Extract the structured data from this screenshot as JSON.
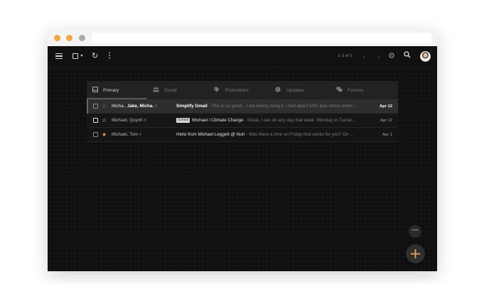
{
  "toolbar": {
    "page_count": "1–3 of 3",
    "icons": [
      "menu-icon",
      "checkbox-icon",
      "refresh-icon",
      "more-vert-icon",
      "chevron-left-icon",
      "chevron-right-icon",
      "gear-icon",
      "search-icon"
    ]
  },
  "tabs": [
    {
      "label": "Primary",
      "icon": "inbox-icon",
      "active": true
    },
    {
      "label": "Social",
      "icon": "people-icon",
      "active": false
    },
    {
      "label": "Promotions",
      "icon": "tag-icon",
      "active": false
    },
    {
      "label": "Updates",
      "icon": "info-icon",
      "active": false
    },
    {
      "label": "Forums",
      "icon": "forum-icon",
      "active": false
    }
  ],
  "emails": [
    {
      "sender_prefix": "Micha., ",
      "sender_bold": "Jake, Micha.",
      "count": "3",
      "label": "",
      "subject": "Simplify Gmail",
      "snippet": " - This is so good... I am loving using it. I feel about 50% less stress when ...",
      "date": "Apr 12",
      "starred": false,
      "unread": true
    },
    {
      "sender_prefix": "Michael, Quynh",
      "sender_bold": "",
      "count": "8",
      "label": "School",
      "subject": "Michael / Climate Change",
      "snippet": " - Great. I can do any day that week. Monday or Tuesd...",
      "date": "Apr 12",
      "starred": false,
      "unread": false
    },
    {
      "sender_prefix": "Michael, Tom",
      "sender_bold": "",
      "count": "4",
      "label": "",
      "subject": "Hello from Michael Leggett @ Nori",
      "snippet": " - Was there a time on Friday that works for you? On ...",
      "date": "Apr 1",
      "starred": true,
      "unread": false
    }
  ],
  "colors": {
    "accent_star": "#e8a35d",
    "window_dot_1": "#f3a44a",
    "window_dot_2": "#f3a44a",
    "window_dot_3": "#aaaaaa"
  }
}
